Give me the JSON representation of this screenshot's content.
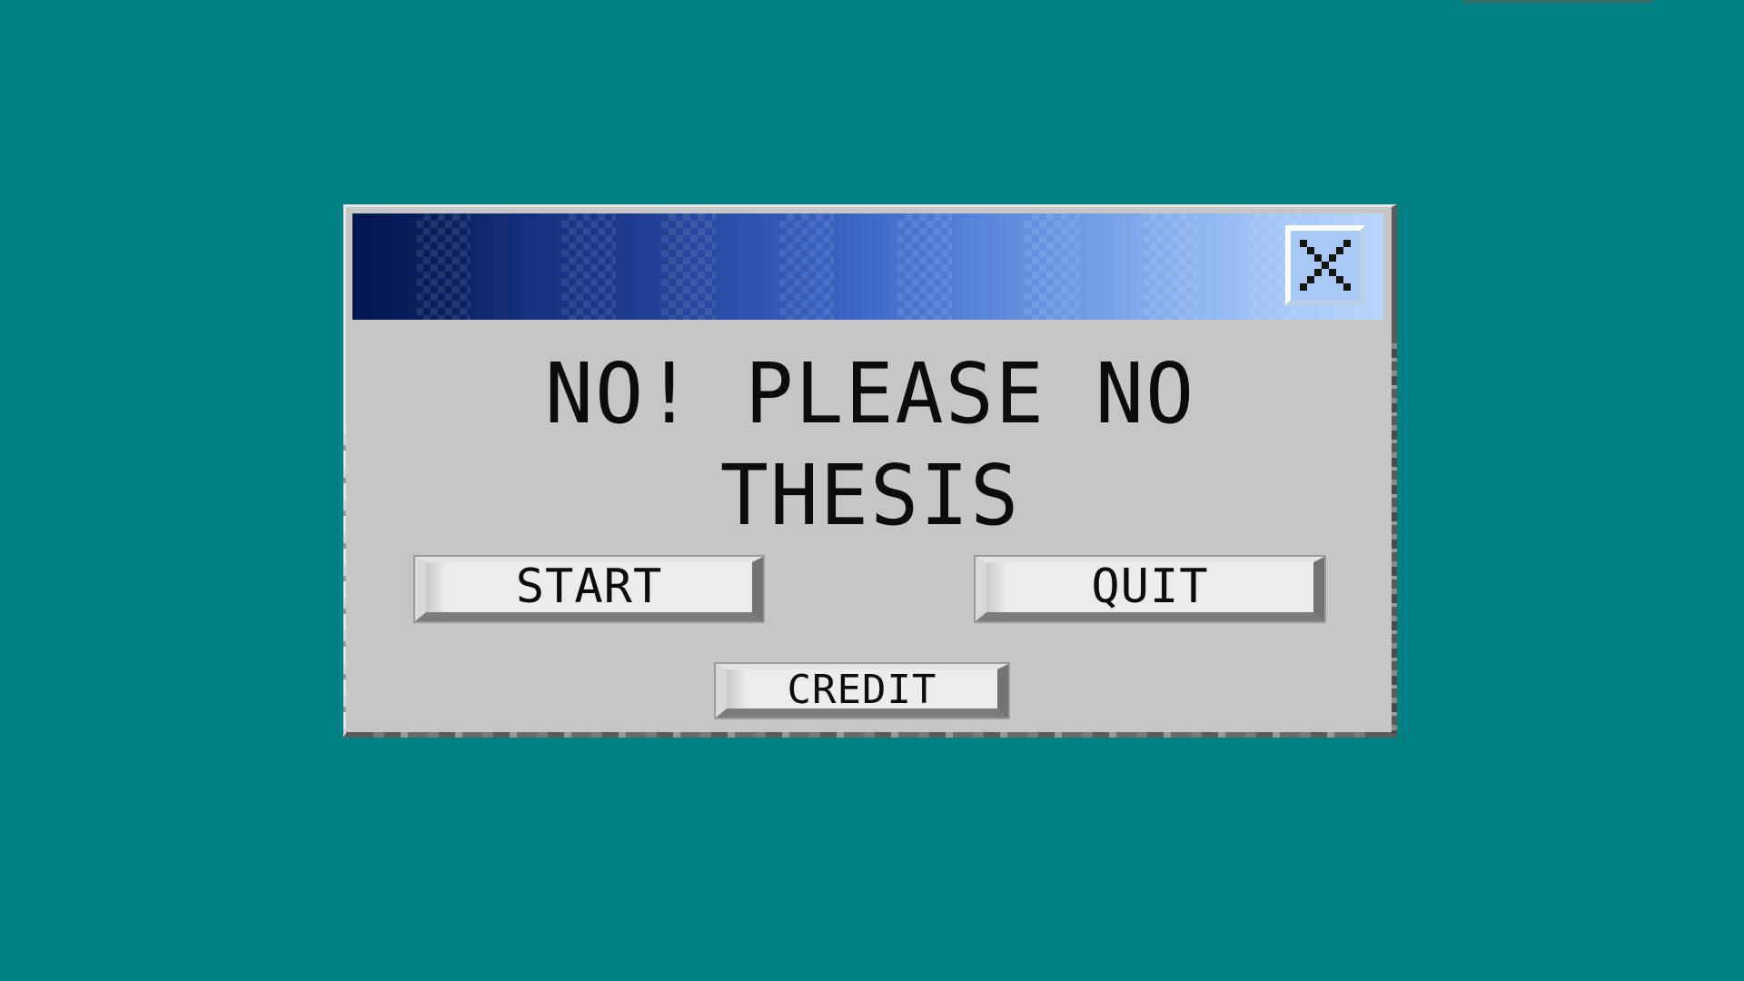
{
  "dialog": {
    "message_line1": "NO! PLEASE NO",
    "message_line2": "THESIS",
    "close_icon": "close-icon"
  },
  "buttons": {
    "start_label": "START",
    "quit_label": "QUIT",
    "credit_label": "CREDIT"
  },
  "colors": {
    "desktop": "#008080",
    "window_face": "#c6c6c6",
    "titlebar_start": "#031550",
    "titlebar_end": "#b9d6fb",
    "text": "#0c0c0c"
  }
}
